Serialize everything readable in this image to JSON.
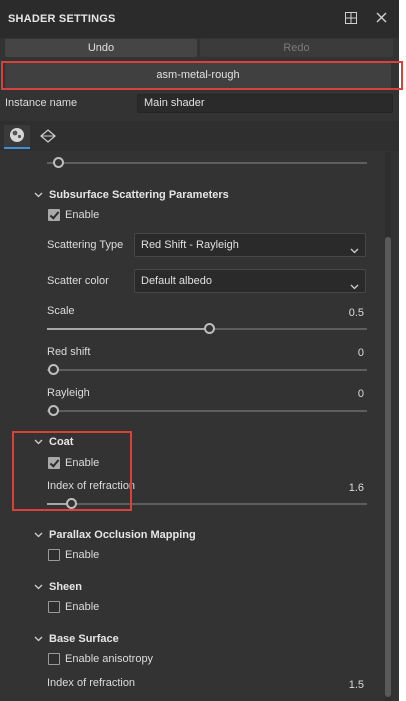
{
  "window": {
    "title": "SHADER SETTINGS",
    "icons": [
      "dock-icon",
      "close-icon"
    ]
  },
  "toolbar": {
    "undo_label": "Undo",
    "redo_label": "Redo"
  },
  "preset": {
    "name": "asm-metal-rough"
  },
  "instance": {
    "label": "Instance name",
    "value": "Main shader"
  },
  "tabs": [
    {
      "icon": "sphere-icon",
      "active": true
    },
    {
      "icon": "geometry-icon",
      "active": false
    }
  ],
  "sections": {
    "top_slider": {
      "value_fraction": 0.02
    },
    "subsurface": {
      "title": "Subsurface Scattering Parameters",
      "enable_label": "Enable",
      "enabled": true,
      "scattering_type_label": "Scattering Type",
      "scattering_type_value": "Red Shift - Rayleigh",
      "scatter_color_label": "Scatter color",
      "scatter_color_value": "Default albedo",
      "scale_label": "Scale",
      "scale_value": "0.5",
      "scale_fraction": 0.5,
      "red_shift_label": "Red shift",
      "red_shift_value": "0",
      "red_shift_fraction": 0.0,
      "rayleigh_label": "Rayleigh",
      "rayleigh_value": "0",
      "rayleigh_fraction": 0.0
    },
    "coat": {
      "title": "Coat",
      "enable_label": "Enable",
      "enabled": true,
      "ior_label": "Index of refraction",
      "ior_value": "1.6",
      "ior_fraction": 0.06
    },
    "parallax": {
      "title": "Parallax Occlusion Mapping",
      "enable_label": "Enable",
      "enabled": false
    },
    "sheen": {
      "title": "Sheen",
      "enable_label": "Enable",
      "enabled": false
    },
    "base": {
      "title": "Base Surface",
      "anisotropy_label": "Enable anisotropy",
      "anisotropy_enabled": false,
      "ior_label": "Index of refraction",
      "ior_value": "1.5"
    }
  },
  "colors": {
    "panel_bg": "#333333",
    "highlight": "#d9413c",
    "tab_accent": "#3d8fd6"
  }
}
